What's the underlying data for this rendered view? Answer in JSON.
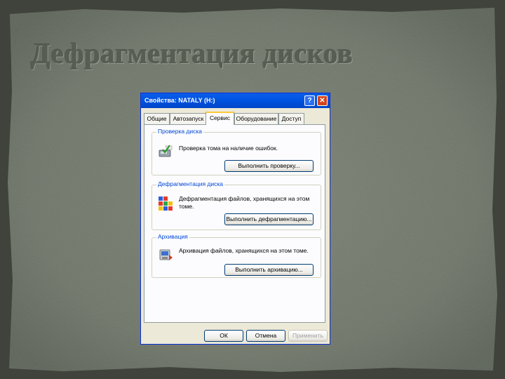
{
  "slide": {
    "title": "Дефрагментация дисков"
  },
  "dialog": {
    "title": "Свойства: NATALY (H:)",
    "help_symbol": "?",
    "close_symbol": "✕",
    "tabs": [
      {
        "label": "Общие",
        "active": false
      },
      {
        "label": "Автозапуск",
        "active": false
      },
      {
        "label": "Сервис",
        "active": true
      },
      {
        "label": "Оборудование",
        "active": false
      },
      {
        "label": "Доступ",
        "active": false
      }
    ],
    "groups": [
      {
        "legend": "Проверка диска",
        "text": "Проверка тома на наличие ошибок.",
        "button": "Выполнить проверку...",
        "icon": "disk-check-icon"
      },
      {
        "legend": "Дефрагментация диска",
        "text": "Дефрагментация файлов, хранящихся на этом томе.",
        "button": "Выполнить дефрагментацию...",
        "icon": "defragment-icon"
      },
      {
        "legend": "Архивация",
        "text": "Архивация файлов, хранящихся на этом томе.",
        "button": "Выполнить архивацию...",
        "icon": "backup-icon"
      }
    ],
    "buttons": {
      "ok": "ОК",
      "cancel": "Отмена",
      "apply": "Применить"
    }
  },
  "colors": {
    "titlebar": "#0054e3",
    "group_legend": "#0046d5",
    "slide_bg": "#6c7366"
  }
}
